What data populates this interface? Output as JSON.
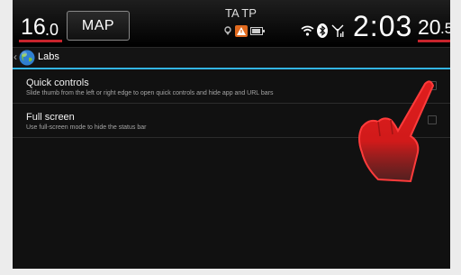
{
  "status_bar": {
    "outside_temp_whole": "16",
    "outside_temp_decimal": ".0",
    "map_label": "MAP",
    "radio_flags": "TA TP",
    "clock": "2:03",
    "inside_temp_whole": "20",
    "inside_temp_decimal": ".5",
    "icons": [
      "gps-icon",
      "warning-icon",
      "battery-icon",
      "wifi-icon",
      "bluetooth-icon",
      "signal-icon"
    ]
  },
  "action_bar": {
    "title": "Labs",
    "back_icon": "chevron-left-icon",
    "app_icon": "globe-icon"
  },
  "settings": [
    {
      "title": "Quick controls",
      "summary": "Slide thumb from the left or right edge to open quick controls and hide app and URL bars",
      "checked": false
    },
    {
      "title": "Full screen",
      "summary": "Use full-screen mode to hide the status bar",
      "checked": false
    }
  ],
  "overlay": {
    "icon": "pointing-hand-icon"
  },
  "colors": {
    "accent": "#33b5e5",
    "temp_underline": "#c8242c",
    "hand": "#e01e1e"
  }
}
